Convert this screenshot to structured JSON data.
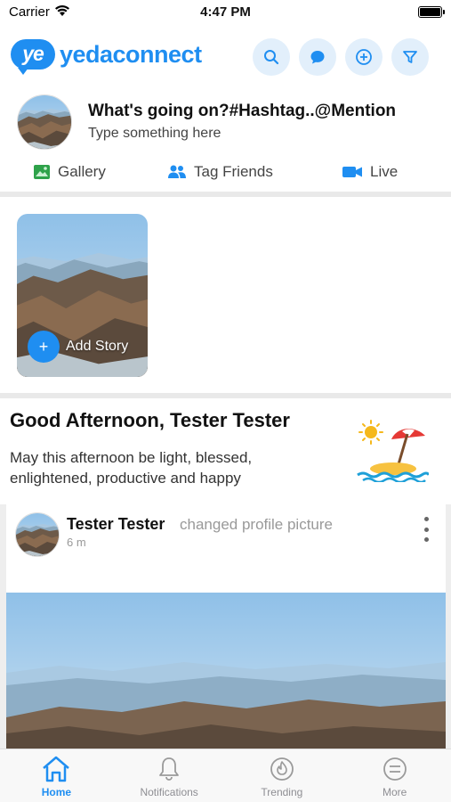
{
  "status_bar": {
    "carrier": "Carrier",
    "time": "4:47 PM"
  },
  "header": {
    "logo_mark": "ye",
    "logo_text": "yedaconnect",
    "icons": [
      "search-icon",
      "chat-icon",
      "add-icon",
      "filter-icon"
    ]
  },
  "composer": {
    "title": "What's going on?#Hashtag..@Mention",
    "subtitle": "Type something here",
    "actions": [
      {
        "label": "Gallery",
        "icon": "gallery-icon",
        "color": "#2ea24a"
      },
      {
        "label": "Tag Friends",
        "icon": "tag-friends-icon",
        "color": "#1f8ef1"
      },
      {
        "label": "Live",
        "icon": "live-video-icon",
        "color": "#1f8ef1"
      }
    ]
  },
  "story": {
    "add_label": "Add Story",
    "add_symbol": "+"
  },
  "greeting": {
    "title": "Good Afternoon, Tester Tester",
    "message": "May this afternoon be light, blessed, enlightened, productive and happy"
  },
  "post": {
    "author": "Tester Tester",
    "action": "changed profile picture",
    "time": "6 m"
  },
  "tabbar": {
    "tabs": [
      {
        "label": "Home",
        "icon": "home-icon",
        "active": true
      },
      {
        "label": "Notifications",
        "icon": "bell-icon",
        "active": false
      },
      {
        "label": "Trending",
        "icon": "flame-icon",
        "active": false
      },
      {
        "label": "More",
        "icon": "more-icon",
        "active": false
      }
    ]
  },
  "colors": {
    "accent": "#1f8ef1",
    "gallery": "#2ea24a",
    "divider": "#e9e9e9"
  }
}
